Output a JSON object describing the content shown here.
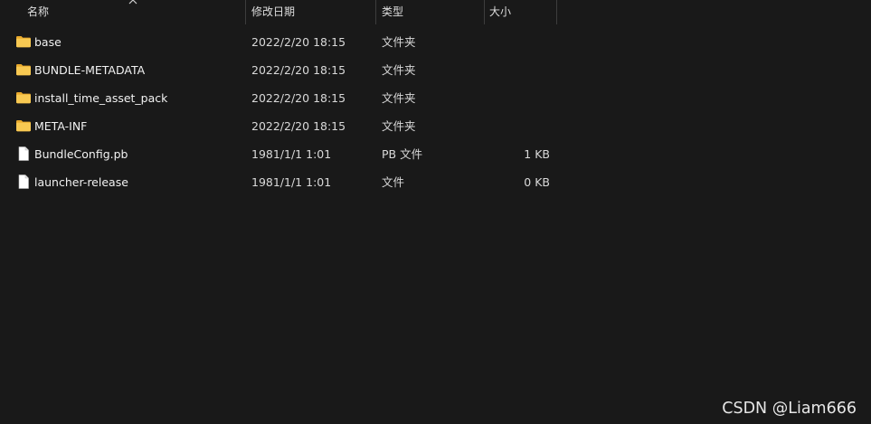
{
  "columns": {
    "name": "名称",
    "date": "修改日期",
    "type": "类型",
    "size": "大小"
  },
  "files": [
    {
      "name": "base",
      "date": "2022/2/20 18:15",
      "type": "文件夹",
      "size": "",
      "icon": "folder-icon"
    },
    {
      "name": "BUNDLE-METADATA",
      "date": "2022/2/20 18:15",
      "type": "文件夹",
      "size": "",
      "icon": "folder-icon"
    },
    {
      "name": "install_time_asset_pack",
      "date": "2022/2/20 18:15",
      "type": "文件夹",
      "size": "",
      "icon": "folder-icon"
    },
    {
      "name": "META-INF",
      "date": "2022/2/20 18:15",
      "type": "文件夹",
      "size": "",
      "icon": "folder-icon"
    },
    {
      "name": "BundleConfig.pb",
      "date": "1981/1/1 1:01",
      "type": "PB 文件",
      "size": "1 KB",
      "icon": "file-icon"
    },
    {
      "name": "launcher-release",
      "date": "1981/1/1 1:01",
      "type": "文件",
      "size": "0 KB",
      "icon": "file-icon"
    }
  ],
  "watermark": "CSDN @Liam666",
  "colors": {
    "background": "#191919",
    "folder": "#f6c24a",
    "text": "#f2f2f2"
  }
}
